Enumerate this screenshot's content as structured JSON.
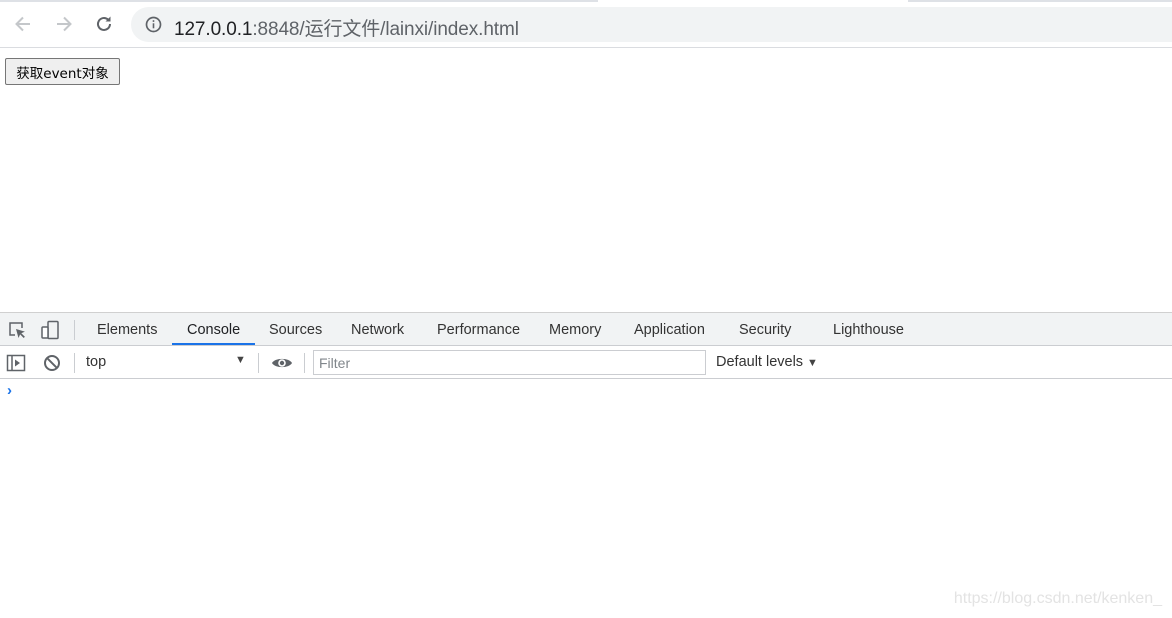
{
  "browser": {
    "url_host": "127.0.0.1",
    "url_rest": ":8848/运行文件/lainxi/index.html"
  },
  "page": {
    "button_label": "获取event对象"
  },
  "devtools": {
    "tabs": [
      {
        "label": "Elements"
      },
      {
        "label": "Console",
        "active": true
      },
      {
        "label": "Sources"
      },
      {
        "label": "Network"
      },
      {
        "label": "Performance"
      },
      {
        "label": "Memory"
      },
      {
        "label": "Application"
      },
      {
        "label": "Security"
      },
      {
        "label": "Lighthouse"
      }
    ],
    "console": {
      "context": "top",
      "filter_placeholder": "Filter",
      "levels_label": "Default levels",
      "prompt_symbol": "›"
    },
    "accent_color": "#1a73e8"
  },
  "watermark": "https://blog.csdn.net/kenken_"
}
